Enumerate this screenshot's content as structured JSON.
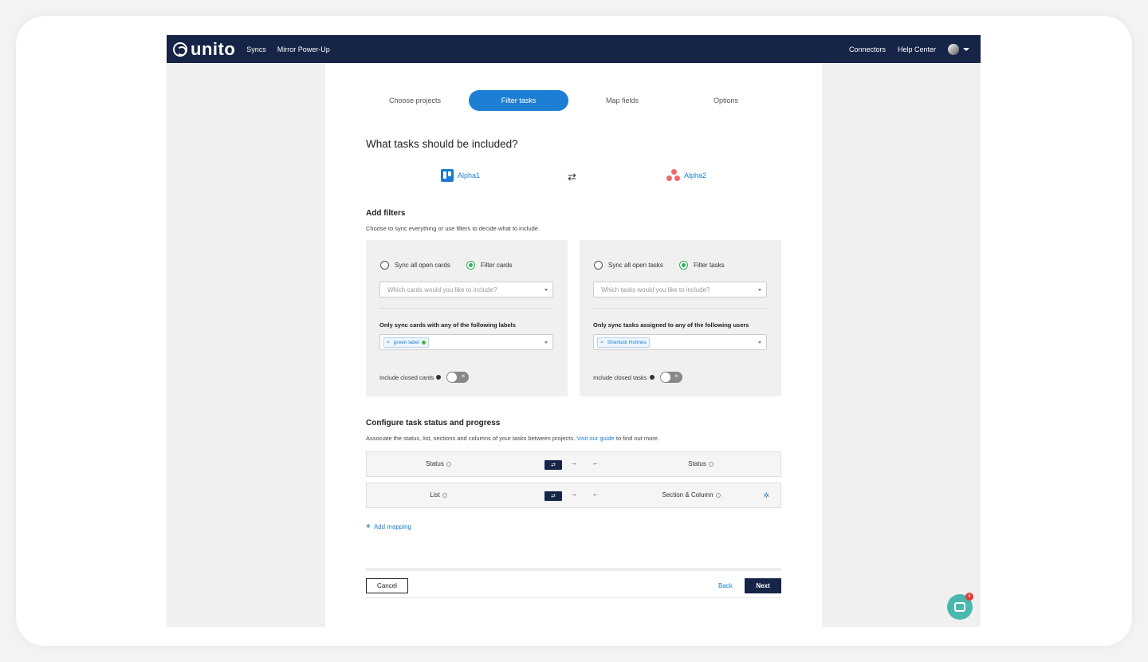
{
  "topbar": {
    "logo": "unito",
    "nav": [
      "Syncs",
      "Mirror Power-Up"
    ],
    "right": [
      "Connectors",
      "Help Center"
    ]
  },
  "steps": [
    "Choose projects",
    "Filter tasks",
    "Map fields",
    "Options"
  ],
  "active_step": "Filter tasks",
  "title": "What tasks should be included?",
  "projects": {
    "left": "Alpha1",
    "right": "Alpha2"
  },
  "filters": {
    "heading": "Add filters",
    "description": "Choose to sync everything or use filters to decide what to include.",
    "left": {
      "radio_all": "Sync all open cards",
      "radio_filter": "Filter cards",
      "select_placeholder": "Which cards would you like to include?",
      "label": "Only sync cards with any of the following labels",
      "chip": "green label",
      "toggle_label": "Include closed cards"
    },
    "right": {
      "radio_all": "Sync all open tasks",
      "radio_filter": "Filter tasks",
      "select_placeholder": "Which tasks would you like to include?",
      "label": "Only sync tasks assigned to any of the following users",
      "chip": "Sherlock Holmes",
      "toggle_label": "Include closed tasks"
    }
  },
  "configure": {
    "heading": "Configure task status and progress",
    "description": "Associate the status, list, sections and columns of your tasks between projects.",
    "link": "Visit our guide",
    "description_end": "to find out more.",
    "rows": [
      {
        "left": "Status",
        "right": "Status"
      },
      {
        "left": "List",
        "right": "Section & Column"
      }
    ],
    "add_mapping": "Add mapping"
  },
  "footer": {
    "cancel": "Cancel",
    "back": "Back",
    "next": "Next"
  },
  "chat_badge": "4",
  "colors": {
    "nav": "#152447",
    "accent": "#1d7fd3",
    "green": "#2fb35a"
  }
}
